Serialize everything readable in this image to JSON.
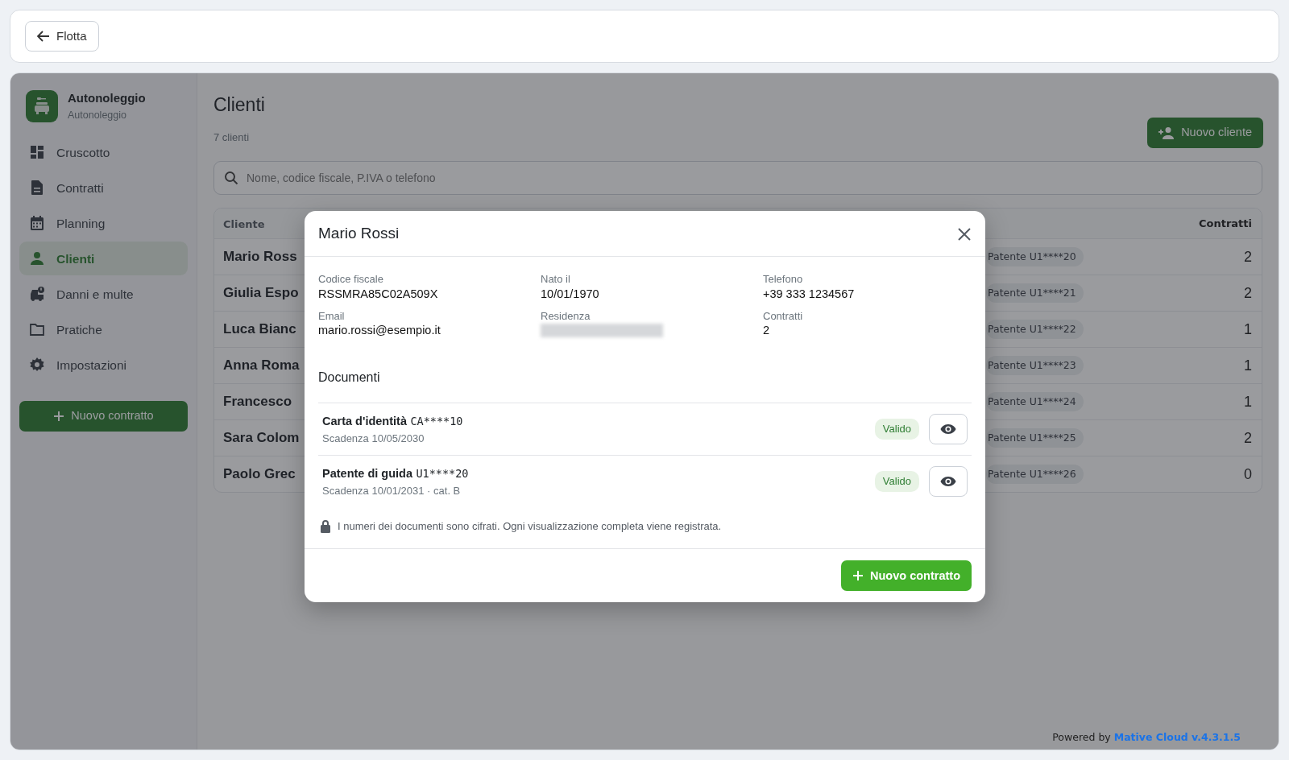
{
  "topbar": {
    "back_button": "Flotta"
  },
  "sidebar": {
    "brand": {
      "title": "Autonoleggio",
      "subtitle": "Autonoleggio"
    },
    "items": [
      {
        "label": "Cruscotto",
        "selected": false
      },
      {
        "label": "Contratti",
        "selected": false
      },
      {
        "label": "Planning",
        "selected": false
      },
      {
        "label": "Clienti",
        "selected": true
      },
      {
        "label": "Danni e multe",
        "selected": false
      },
      {
        "label": "Pratiche",
        "selected": false
      },
      {
        "label": "Impostazioni",
        "selected": false
      }
    ],
    "action_button": "Nuovo contratto"
  },
  "page": {
    "title": "Clienti",
    "count": "7 clienti",
    "new_button": "Nuovo cliente",
    "search": {
      "placeholder": "Nome, codice fiscale, P.IVA o telefono"
    }
  },
  "table": {
    "columns": [
      "Cliente",
      "Contratti"
    ],
    "rows": [
      {
        "name": "Mario Ross",
        "document": "Patente U1****20",
        "contracts": "2"
      },
      {
        "name": "Giulia Espo",
        "document": "Patente U1****21",
        "contracts": "2"
      },
      {
        "name": "Luca Bianc",
        "document": "Patente U1****22",
        "contracts": "1"
      },
      {
        "name": "Anna Roma",
        "document": "Patente U1****23",
        "contracts": "1"
      },
      {
        "name": "Francesco",
        "document": "Patente U1****24",
        "contracts": "1"
      },
      {
        "name": "Sara Colom",
        "document": "Patente U1****25",
        "contracts": "2"
      },
      {
        "name": "Paolo Grec",
        "document": "Patente U1****26",
        "contracts": "0"
      }
    ]
  },
  "modal": {
    "title": "Mario Rossi",
    "fields": [
      {
        "label": "Codice fiscale",
        "value": "RSSMRA85C02A509X"
      },
      {
        "label": "Nato il",
        "value": "10/01/1970"
      },
      {
        "label": "Telefono",
        "value": "+39 333 1234567"
      },
      {
        "label": "Email",
        "value": "mario.rossi@esempio.it"
      },
      {
        "label": "Residenza",
        "redacted": true
      },
      {
        "label": "Contratti",
        "value": "2"
      }
    ],
    "documents_heading": "Documenti",
    "documents": [
      {
        "name": "Carta d'identità",
        "number": "CA****10",
        "detail": "Scadenza 10/05/2030",
        "status": "Valido"
      },
      {
        "name": "Patente di guida",
        "number": "U1****20",
        "detail": "Scadenza 10/01/2031 · cat. B",
        "status": "Valido"
      }
    ],
    "note": "I numeri dei documenti sono cifrati. Ogni visualizzazione completa viene registrata.",
    "primary_button": "Nuovo contratto"
  },
  "footer": {
    "prefix": "Powered by",
    "link": "Mative Cloud v.4.3.1.5"
  }
}
